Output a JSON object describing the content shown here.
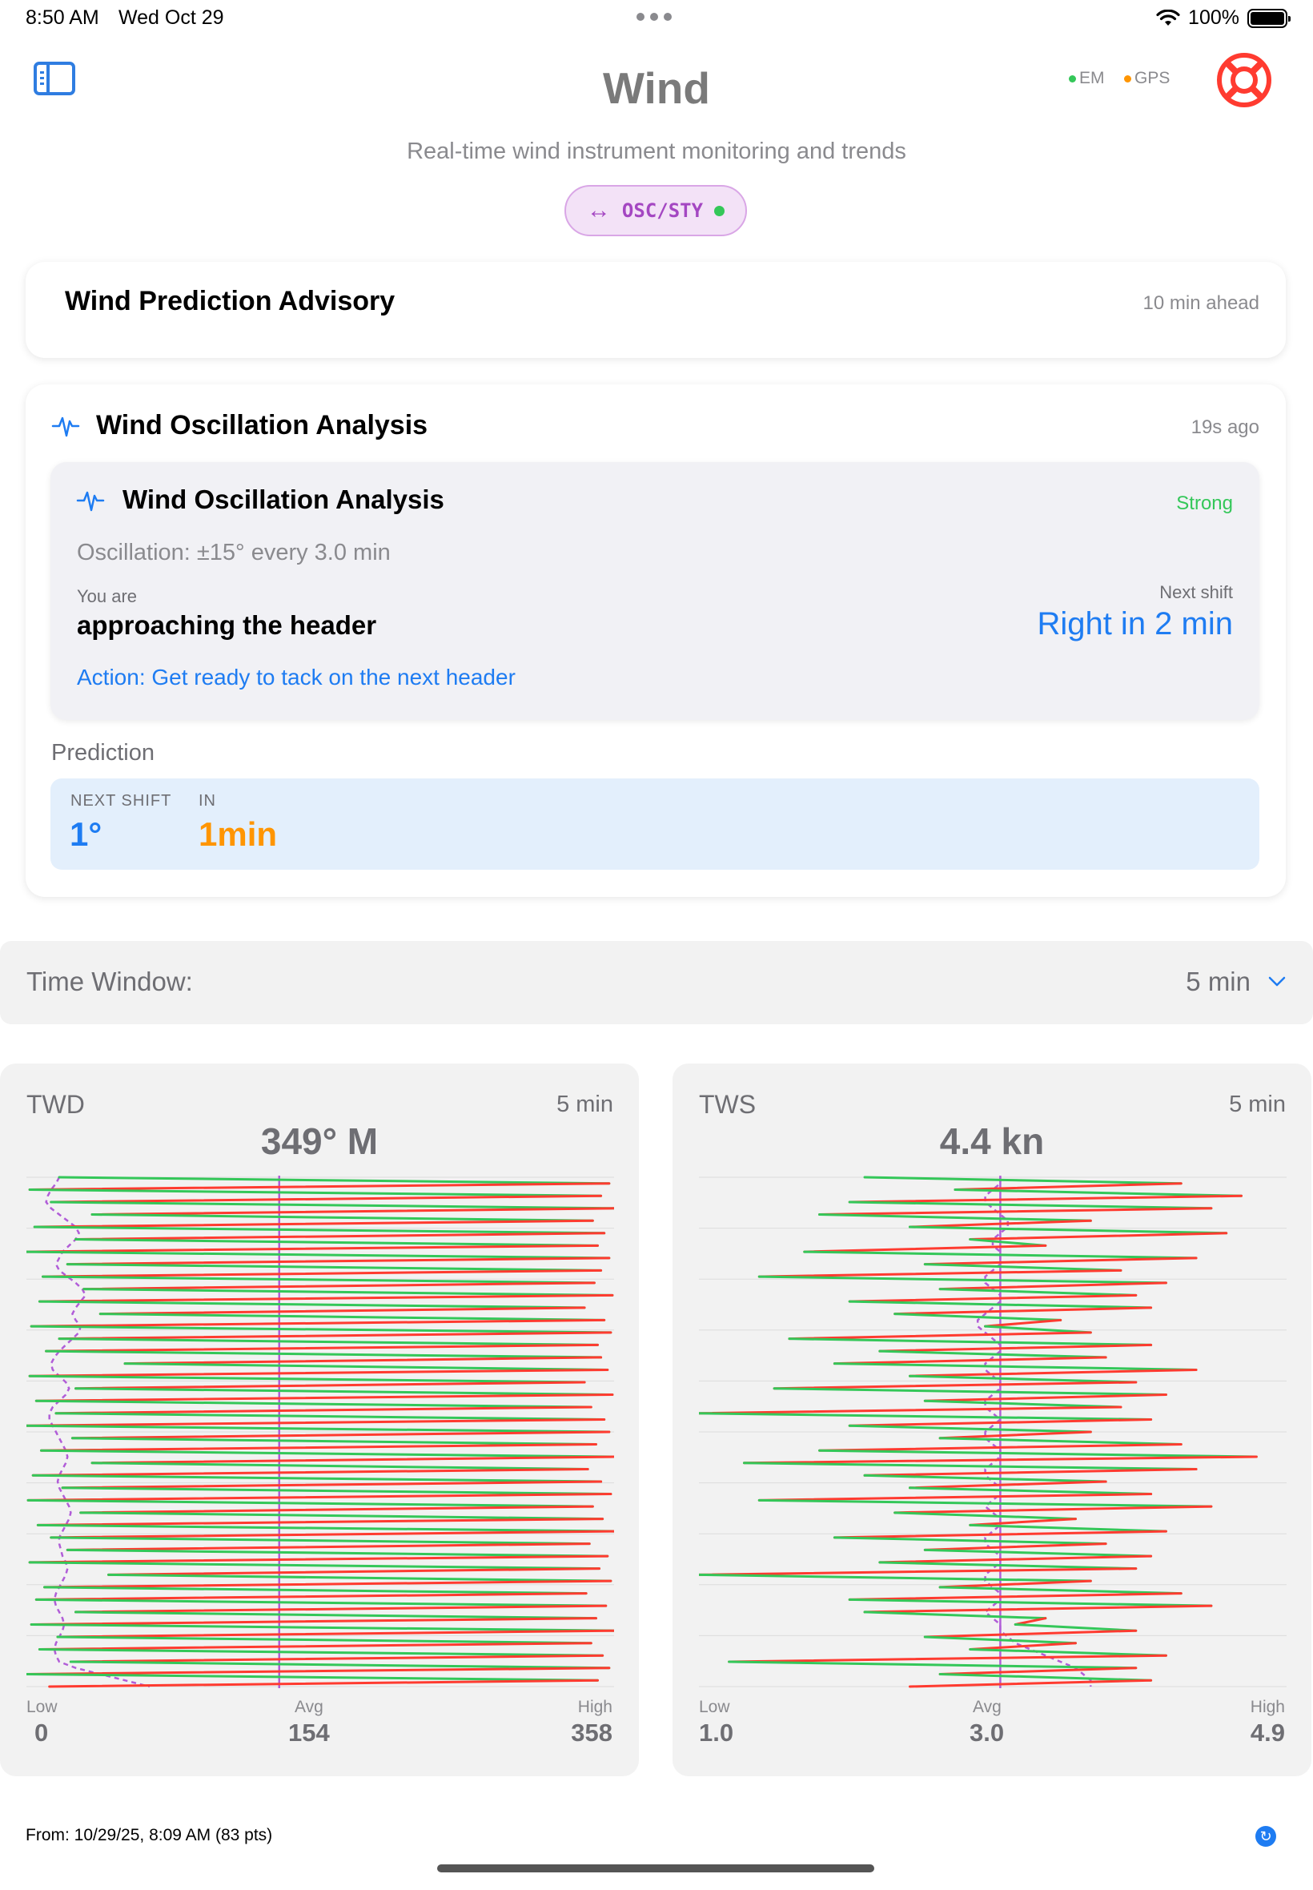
{
  "status_bar": {
    "time": "8:50 AM",
    "date": "Wed Oct 29",
    "battery": "100%"
  },
  "header": {
    "title": "Wind",
    "subtitle": "Real-time wind instrument monitoring and trends",
    "mode_label": "OSC/STY",
    "sensors": [
      {
        "label": "EM",
        "color": "#34c759"
      },
      {
        "label": "GPS",
        "color": "#ff9500"
      }
    ],
    "help_icon_color": "#ff3b30"
  },
  "advisory": {
    "title": "Wind Prediction Advisory",
    "horizon": "10 min ahead"
  },
  "oscillation": {
    "title": "Wind Oscillation Analysis",
    "updated": "19s ago",
    "detail": {
      "title": "Wind Oscillation Analysis",
      "strength": "Strong",
      "summary": "Oscillation: ±15° every 3.0 min",
      "position_label": "You are",
      "position_value": "approaching the header",
      "next_shift_label": "Next shift",
      "next_shift_value": "Right in 2 min",
      "action": "Action: Get ready to tack on the next header"
    },
    "prediction": {
      "heading": "Prediction",
      "next_shift_label": "NEXT SHIFT",
      "next_shift_value": "1°",
      "in_label": "IN",
      "in_value": "1min"
    }
  },
  "time_window": {
    "label": "Time Window:",
    "value": "5 min"
  },
  "panels": [
    {
      "label": "TWD",
      "window": "5 min",
      "value": "349° M",
      "low_label": "Low",
      "low": "0",
      "avg_label": "Avg",
      "avg": "154",
      "high_label": "High",
      "high": "358"
    },
    {
      "label": "TWS",
      "window": "5 min",
      "value": "4.4 kn",
      "low_label": "Low",
      "low": "1.0",
      "avg_label": "Avg",
      "avg": "3.0",
      "high_label": "High",
      "high": "4.9"
    }
  ],
  "chart_data": [
    {
      "type": "line",
      "label": "TWD",
      "orientation": "vertical-time",
      "xlim": [
        0,
        358
      ],
      "avg": 154,
      "segment_colors": {
        "increasing": "#34c759",
        "decreasing": "#ff3b30",
        "avg_line": "#b15dd8"
      },
      "values": [
        20,
        355,
        2,
        350,
        15,
        358,
        40,
        345,
        5,
        352,
        30,
        348,
        0,
        355,
        25,
        350,
        10,
        346,
        35,
        357,
        8,
        340,
        45,
        352,
        3,
        356,
        20,
        348,
        12,
        350,
        60,
        354,
        2,
        340,
        30,
        357,
        6,
        344,
        18,
        352,
        0,
        355,
        28,
        347,
        9,
        358,
        40,
        342,
        4,
        350,
        22,
        356,
        1,
        345,
        33,
        351,
        7,
        358,
        15,
        343,
        25,
        354,
        2,
        349,
        50,
        356,
        11,
        341,
        6,
        353,
        30,
        347,
        3,
        358,
        19,
        344,
        8,
        351,
        27,
        355,
        0,
        348,
        14
      ],
      "smoothed": [
        20,
        18,
        15,
        13,
        12,
        15,
        20,
        25,
        30,
        32,
        30,
        26,
        22,
        20,
        18,
        20,
        25,
        30,
        34,
        36,
        33,
        30,
        28,
        30,
        33,
        32,
        28,
        24,
        20,
        17,
        15,
        16,
        20,
        24,
        26,
        24,
        20,
        16,
        14,
        14,
        16,
        18,
        20,
        22,
        24,
        25,
        24,
        22,
        20,
        19,
        20,
        22,
        24,
        26,
        27,
        26,
        24,
        22,
        20,
        20,
        21,
        22,
        24,
        25,
        24,
        22,
        20,
        18,
        17,
        18,
        20,
        22,
        23,
        22,
        20,
        18,
        17,
        18,
        20,
        30,
        45,
        60,
        75
      ]
    },
    {
      "type": "line",
      "label": "TWS",
      "orientation": "vertical-time",
      "xlim": [
        1.0,
        4.9
      ],
      "avg": 3.0,
      "segment_colors": {
        "increasing": "#34c759",
        "decreasing": "#ff3b30",
        "avg_line": "#b15dd8"
      },
      "values": [
        2.1,
        4.2,
        2.7,
        4.6,
        2.0,
        4.4,
        1.8,
        3.6,
        2.4,
        4.5,
        2.8,
        3.3,
        1.7,
        4.3,
        2.5,
        3.8,
        1.4,
        4.1,
        2.6,
        3.9,
        2.0,
        4.0,
        2.3,
        3.4,
        2.9,
        3.6,
        1.6,
        4.0,
        2.2,
        3.7,
        1.9,
        4.3,
        2.4,
        3.9,
        1.5,
        4.1,
        2.5,
        3.8,
        0.9,
        4.0,
        2.0,
        3.6,
        2.6,
        4.2,
        1.8,
        4.7,
        1.3,
        4.3,
        2.1,
        3.7,
        2.4,
        4.0,
        1.4,
        4.4,
        2.3,
        3.5,
        2.8,
        4.1,
        1.9,
        3.7,
        2.5,
        4.0,
        2.2,
        3.9,
        1.0,
        3.6,
        2.6,
        4.2,
        2.0,
        4.4,
        2.1,
        3.3,
        3.1,
        3.9,
        2.5,
        3.5,
        2.8,
        4.1,
        1.2,
        3.9,
        2.6,
        4.0,
        2.4
      ],
      "smoothed": [
        3.0,
        3.0,
        2.95,
        2.9,
        2.9,
        2.95,
        3.0,
        3.05,
        3.05,
        3.0,
        2.95,
        2.95,
        3.0,
        3.0,
        3.0,
        2.95,
        2.9,
        2.9,
        2.95,
        3.0,
        3.0,
        2.95,
        2.9,
        2.85,
        2.85,
        2.9,
        2.95,
        3.0,
        3.0,
        2.95,
        2.9,
        2.9,
        2.95,
        3.0,
        3.0,
        2.95,
        2.9,
        2.9,
        2.95,
        3.0,
        2.95,
        2.9,
        2.9,
        2.95,
        3.0,
        3.0,
        2.95,
        2.9,
        2.9,
        2.95,
        3.0,
        3.0,
        2.95,
        2.9,
        2.95,
        3.0,
        3.0,
        2.95,
        2.9,
        2.9,
        2.95,
        3.0,
        3.0,
        2.95,
        2.9,
        2.9,
        2.95,
        3.0,
        3.0,
        2.95,
        2.9,
        2.95,
        3.0,
        3.0,
        3.05,
        3.1,
        3.2,
        3.3,
        3.4,
        3.5,
        3.55,
        3.6,
        3.6
      ]
    }
  ],
  "footer": {
    "source": "From: 10/29/25, 8:09 AM (83 pts)"
  }
}
